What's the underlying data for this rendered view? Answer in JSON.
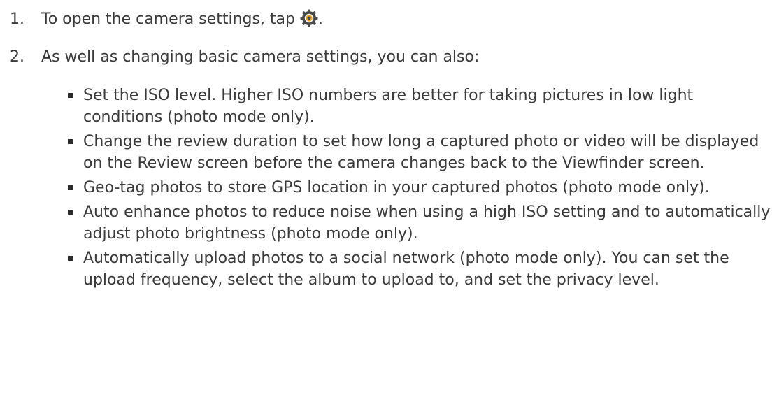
{
  "steps": [
    {
      "number": "1.",
      "text_before_icon": "To open the camera settings, tap ",
      "icon": "camera-settings-gear-icon",
      "text_after_icon": "."
    },
    {
      "number": "2.",
      "text": "As well as changing basic camera settings, you can also:"
    }
  ],
  "bullets": [
    "Set the ISO level. Higher ISO numbers are better for taking pictures in low light conditions (photo mode only).",
    "Change the review duration to set how long a captured photo or video will be displayed on the Review screen before the camera changes back to the Viewfinder screen.",
    "Geo-tag photos to store GPS location in your captured photos (photo mode only).",
    "Auto enhance photos to reduce noise when using a high ISO setting and to automatically adjust photo brightness (photo mode only).",
    "Automatically upload photos to a social network (photo mode only). You can set the upload frequency, select the album to upload to, and set the privacy level."
  ],
  "colors": {
    "text": "#3a3a3a",
    "icon_dark": "#4a4a4a",
    "icon_accent": "#f0a020"
  }
}
